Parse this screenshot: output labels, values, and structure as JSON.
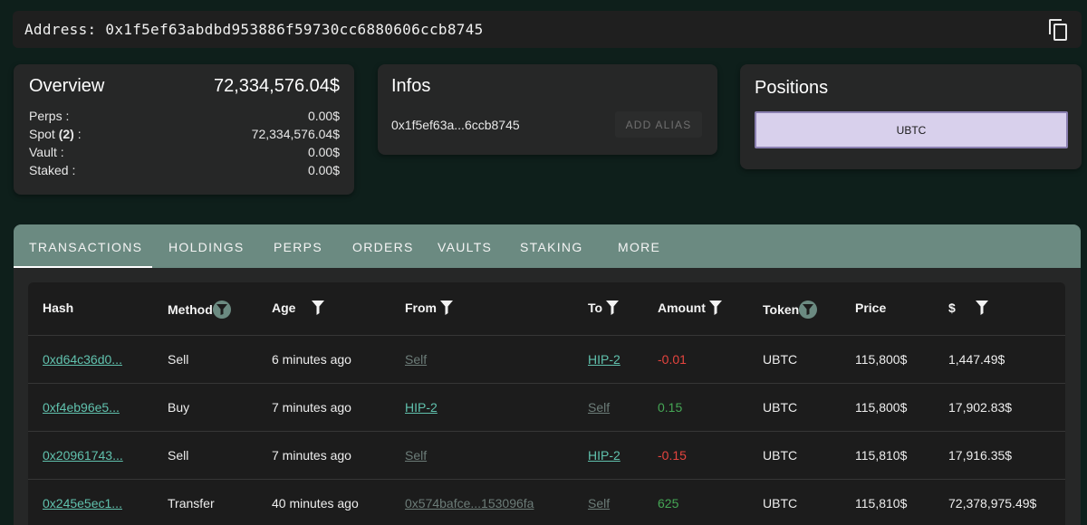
{
  "address_bar": {
    "label": "Address: 0x1f5ef63abdbd953886f59730cc6880606ccb8745",
    "copy_icon": "copy-icon"
  },
  "overview": {
    "title": "Overview",
    "total": "72,334,576.04$",
    "rows": [
      {
        "label": "Perps :",
        "value": "0.00$"
      },
      {
        "label_pre": "Spot ",
        "label_bold": "(2)",
        "label_post": " :",
        "value": "72,334,576.04$"
      },
      {
        "label": "Vault :",
        "value": "0.00$"
      },
      {
        "label": "Staked :",
        "value": "0.00$"
      }
    ]
  },
  "infos": {
    "title": "Infos",
    "address_short": "0x1f5ef63a...6ccb8745",
    "add_alias": "ADD ALIAS"
  },
  "positions": {
    "title": "Positions",
    "chip": "UBTC"
  },
  "tabs": [
    {
      "label": "TRANSACTIONS",
      "active": true
    },
    {
      "label": "HOLDINGS"
    },
    {
      "label": "PERPS"
    },
    {
      "label": "ORDERS"
    },
    {
      "label": "VAULTS"
    },
    {
      "label": "STAKING"
    },
    {
      "label": "MORE"
    }
  ],
  "table": {
    "headers": [
      "Hash",
      "Method",
      "Age",
      "From",
      "To",
      "Amount",
      "Token",
      "Price",
      "$"
    ],
    "rows": [
      {
        "hash": "0xd64c36d0...",
        "method": "Sell",
        "age": "6 minutes ago",
        "from": "Self",
        "to": "HIP-2",
        "amount": "-0.01",
        "token": "UBTC",
        "price": "115,800$",
        "usd": "1,447.49$"
      },
      {
        "hash": "0xf4eb96e5...",
        "method": "Buy",
        "age": "7 minutes ago",
        "from": "HIP-2",
        "to": "Self",
        "amount": "0.15",
        "token": "UBTC",
        "price": "115,800$",
        "usd": "17,902.83$"
      },
      {
        "hash": "0x20961743...",
        "method": "Sell",
        "age": "7 minutes ago",
        "from": "Self",
        "to": "HIP-2",
        "amount": "-0.15",
        "token": "UBTC",
        "price": "115,810$",
        "usd": "17,916.35$"
      },
      {
        "hash": "0x245e5ec1...",
        "method": "Transfer",
        "age": "40 minutes ago",
        "from": "0x574bafce...153096fa",
        "to": "Self",
        "amount": "625",
        "token": "UBTC",
        "price": "115,810$",
        "usd": "72,378,975.49$"
      }
    ]
  },
  "colors": {
    "background": "#0e1f1b",
    "card": "#262727",
    "tab_bar": "#6b8a81",
    "link": "#60c1ad",
    "negative": "#e5443e",
    "positive": "#45a655",
    "chip": "#d8d0ec"
  }
}
